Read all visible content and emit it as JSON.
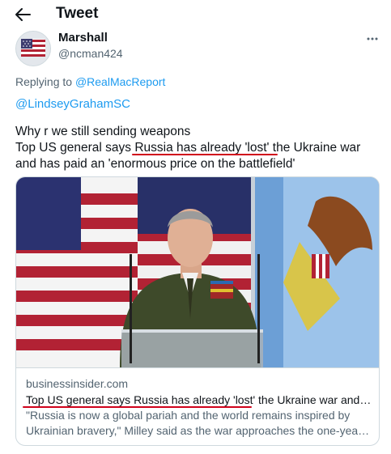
{
  "header": {
    "title": "Tweet",
    "back_icon": "arrow-left-icon"
  },
  "tweet": {
    "author": {
      "name": "Marshall",
      "handle": "@ncman424",
      "avatar_icon": "flag-avatar"
    },
    "more_icon": "more-dots-icon",
    "replying_to_label": "Replying to",
    "replying_to_1": "@RealMacReport",
    "replying_to_2": "@LindseyGrahamSC",
    "text_lines": [
      "Why r we still sending weapons",
      "Top US general says Russia has already 'lost' the Ukraine war",
      "and has paid an 'enormous price on the battlefield'"
    ]
  },
  "card": {
    "image_description_icon": "general-at-podium-image",
    "domain": "businessinsider.com",
    "title": "Top US general says Russia has already 'lost' the Ukraine war and h...",
    "description_lines": [
      "\"Russia is now a global pariah and the world remains inspired by",
      "Ukrainian bravery,\" Milley said as the war approaches the one-year ..."
    ]
  },
  "colors": {
    "accent": "#1d9bf0",
    "secondary_text": "#536471",
    "annotation_red": "#d0021b"
  }
}
